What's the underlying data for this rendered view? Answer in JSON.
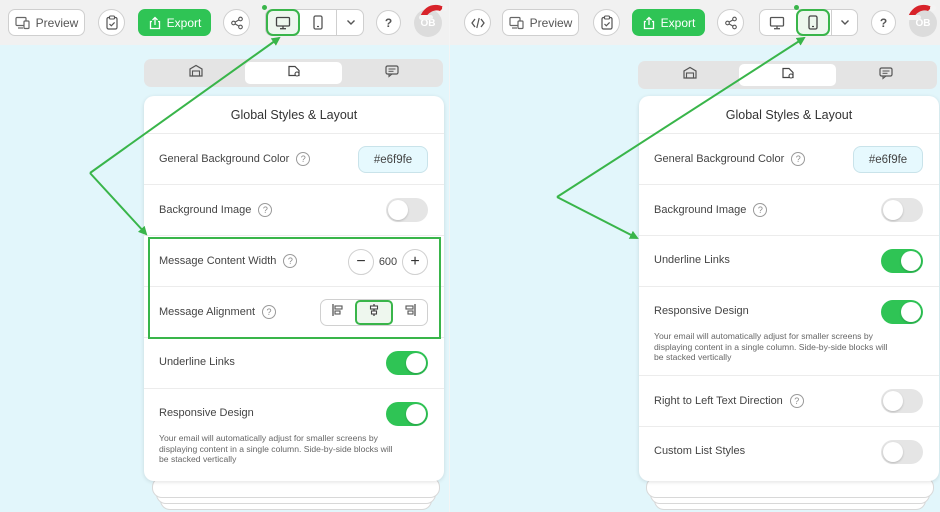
{
  "toolbar": {
    "preview_label": "Preview",
    "export_label": "Export",
    "avatar_initials": "OB",
    "help_symbol": "?"
  },
  "settings": {
    "title": "Global Styles & Layout",
    "background_color_label": "General Background Color",
    "background_color_value": "#e6f9fe",
    "background_image_label": "Background Image",
    "content_width_label": "Message Content Width",
    "content_width_value": "600",
    "alignment_label": "Message Alignment",
    "underline_links_label": "Underline Links",
    "responsive_design_label": "Responsive Design",
    "responsive_desc_line1": "Your email will automatically adjust for smaller screens by",
    "responsive_desc_line2": "displaying content in a single column. Side-by-side blocks will",
    "responsive_desc_line3": "be stacked vertically",
    "rtl_label": "Right to Left Text Direction",
    "custom_list_label": "Custom List Styles",
    "help_symbol": "?"
  },
  "states": {
    "desktop": {
      "background_image": false,
      "underline_links": true,
      "responsive_design": true,
      "alignment": "center"
    },
    "mobile": {
      "background_image": false,
      "underline_links": true,
      "responsive_design": true,
      "rtl": false,
      "custom_list": false
    }
  },
  "colors": {
    "accent_green": "#2fc455",
    "highlight_green": "#39b54a",
    "canvas_background": "#e2f6fb",
    "background_color_swatch": "#e6f9fe"
  },
  "icons": {
    "code": "code-icon",
    "preview": "preview-icon",
    "clipboard": "clipboard-check-icon",
    "export": "upload-icon",
    "share": "share-icon",
    "desktop": "desktop-icon",
    "mobile": "mobile-icon",
    "dropdown": "chevron-down-icon",
    "help": "help-icon",
    "hat": "santa-hat-icon",
    "tab_content": "content-tab-icon",
    "tab_styles": "styles-tab-icon",
    "tab_comments": "comments-tab-icon",
    "align_left": "align-left-icon",
    "align_center": "align-center-icon",
    "align_right": "align-right-icon"
  }
}
